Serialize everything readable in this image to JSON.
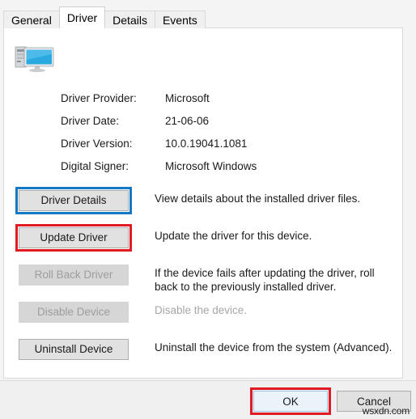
{
  "dialog": {
    "device_icon": "computer-desktop-icon"
  },
  "tabs": [
    {
      "label": "General",
      "active": false
    },
    {
      "label": "Driver",
      "active": true
    },
    {
      "label": "Details",
      "active": false
    },
    {
      "label": "Events",
      "active": false
    }
  ],
  "driver_info": [
    {
      "label": "Driver Provider:",
      "value": "Microsoft"
    },
    {
      "label": "Driver Date:",
      "value": "21-06-06"
    },
    {
      "label": "Driver Version:",
      "value": "10.0.19041.1081"
    },
    {
      "label": "Digital Signer:",
      "value": "Microsoft Windows"
    }
  ],
  "actions": [
    {
      "button": "Driver Details",
      "description": "View details about the installed driver files.",
      "state": "enabled",
      "highlight": "blue"
    },
    {
      "button": "Update Driver",
      "description": "Update the driver for this device.",
      "state": "enabled",
      "highlight": "red"
    },
    {
      "button": "Roll Back Driver",
      "description": "If the device fails after updating the driver, roll back to the previously installed driver.",
      "state": "disabled",
      "highlight": "none"
    },
    {
      "button": "Disable Device",
      "description": "Disable the device.",
      "state": "disabled",
      "highlight": "none"
    },
    {
      "button": "Uninstall Device",
      "description": "Uninstall the device from the system (Advanced).",
      "state": "enabled",
      "highlight": "none"
    }
  ],
  "footer": {
    "ok_label": "OK",
    "cancel_label": "Cancel"
  },
  "watermark": "wsxdn.com",
  "colors": {
    "highlight_blue": "#1479c4",
    "highlight_red": "#e01b24",
    "default_button_fill": "#eaf2fa",
    "button_fill": "#e1e1e1",
    "disabled_text": "#9d9d9d"
  }
}
